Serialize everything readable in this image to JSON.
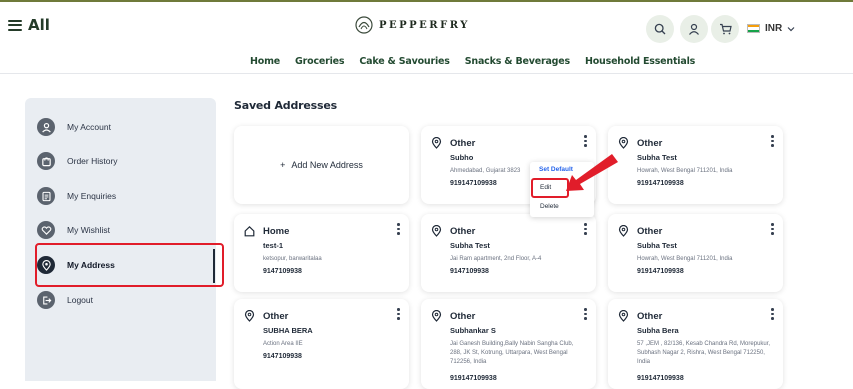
{
  "header": {
    "all_label": "All",
    "logo_text": "PEPPERFRY",
    "currency": "INR",
    "brand_color": "#243b29",
    "icons": [
      "search-icon",
      "user-icon",
      "cart-icon",
      "chevron-down-icon"
    ]
  },
  "nav": {
    "items": [
      "Home",
      "Groceries",
      "Cake & Savouries",
      "Snacks & Beverages",
      "Household Essentials"
    ]
  },
  "sidebar": {
    "items": [
      {
        "label": "My Account",
        "icon": "user-icon"
      },
      {
        "label": "Order History",
        "icon": "bag-icon"
      },
      {
        "label": "My Enquiries",
        "icon": "document-icon"
      },
      {
        "label": "My Wishlist",
        "icon": "heart-icon"
      },
      {
        "label": "My Address",
        "icon": "location-pin-icon",
        "active": true
      },
      {
        "label": "Logout",
        "icon": "logout-icon"
      }
    ]
  },
  "main": {
    "title": "Saved Addresses",
    "add_label": "Add New Address",
    "add_icon_text": "+",
    "cards": [
      {
        "type": "Other",
        "name": "Subho",
        "address": "Ahmedabad, Gujarat 3823",
        "phone": "919147109938"
      },
      {
        "type": "Other",
        "name": "Subha Test",
        "address": "Howrah, West Bengal 711201, India",
        "phone": "919147109938"
      },
      {
        "type": "Home",
        "name": "test-1",
        "address": "ketsopur, barwaritalaa",
        "phone": "9147109938"
      },
      {
        "type": "Other",
        "name": "Subha Test",
        "address": "Jai Ram apartment, 2nd Floor, A-4",
        "phone": "9147109938"
      },
      {
        "type": "Other",
        "name": "Subha Test",
        "address": "Howrah, West Bengal 711201, India",
        "phone": "919147109938"
      },
      {
        "type": "Other",
        "name": "SUBHA BERA",
        "address": "Action Area IIE",
        "phone": "9147109938"
      },
      {
        "type": "Other",
        "name": "Subhankar S",
        "address": "Jai Ganesh Building,Bally Nabin Sangha Club, 288, JK St, Kotrung, Uttarpara, West Bengal 712256, India",
        "phone": "919147109938"
      },
      {
        "type": "Other",
        "name": "Subha Bera",
        "address": "57 ,JEM , 82/136, Kesab Chandra Rd, Morepukur, Subhash Nagar 2, Rishra, West Bengal 712250, India",
        "phone": "919147109938"
      }
    ]
  },
  "dropdown": {
    "set_default": "Set Default",
    "edit": "Edit",
    "delete": "Delete"
  },
  "colors": {
    "highlight": "#e11d2a",
    "link_blue": "#2563eb",
    "sidebar_bg": "#e9edf2"
  }
}
